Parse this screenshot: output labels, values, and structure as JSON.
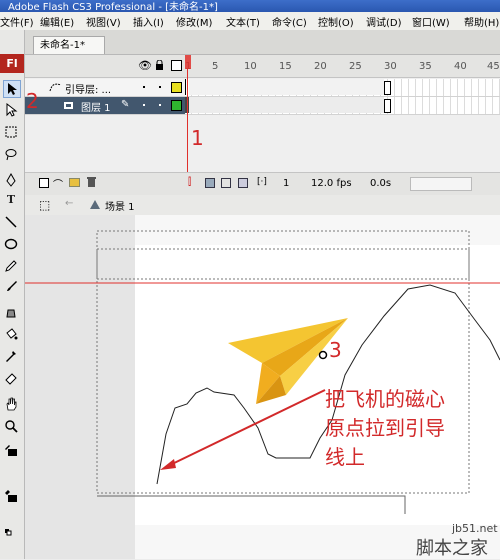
{
  "window": {
    "title": "Adobe Flash CS3 Professional - [未命名-1*]"
  },
  "menu": [
    "文件(F)",
    "编辑(E)",
    "视图(V)",
    "插入(I)",
    "修改(M)",
    "文本(T)",
    "命令(C)",
    "控制(O)",
    "调试(D)",
    "窗口(W)",
    "帮助(H)"
  ],
  "toolbox": {
    "logo": "Fl"
  },
  "document": {
    "tab": "未命名-1*"
  },
  "timeline": {
    "frame_numbers": [
      "1",
      "5",
      "10",
      "15",
      "20",
      "25",
      "30",
      "35",
      "40",
      "45"
    ],
    "layers": [
      {
        "name": "引导层: ...",
        "type": "guide-layer",
        "color": "#e8e020"
      },
      {
        "name": "图层 1",
        "type": "normal-layer",
        "color": "#2fb52f",
        "selected": true
      }
    ],
    "status": {
      "frame": "1",
      "fps": "12.0 fps",
      "time": "0.0s"
    }
  },
  "scene": {
    "label": "场景 1"
  },
  "annotations": {
    "step1": "1",
    "step2": "2",
    "step3": "3",
    "instruction_lines": [
      "把飞机的磁心",
      "原点拉到引导",
      "线上"
    ],
    "color": "#d2292a"
  },
  "watermark": {
    "site": "jb51.net",
    "name": "脚本之家"
  }
}
